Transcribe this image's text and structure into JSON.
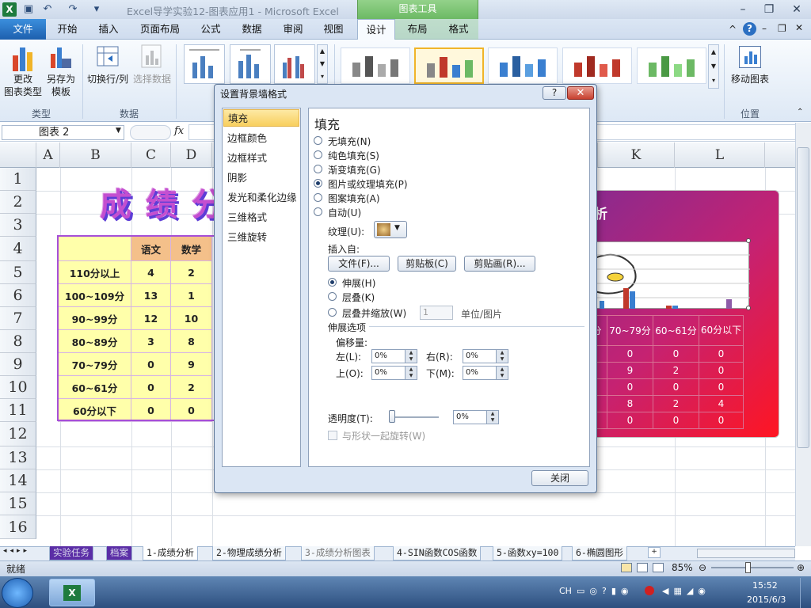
{
  "window": {
    "title": "Excel导学实验12-图表应用1 - Microsoft Excel",
    "context_group": "图表工具"
  },
  "tabs": {
    "file": "文件",
    "home": "开始",
    "insert": "插入",
    "page_layout": "页面布局",
    "formulas": "公式",
    "data": "数据",
    "review": "审阅",
    "view": "视图",
    "design": "设计",
    "layout": "布局",
    "format": "格式"
  },
  "ribbon": {
    "change_type_1": "更改",
    "change_type_2": "图表类型",
    "save_template_1": "另存为",
    "save_template_2": "模板",
    "switch_rowcol": "切换行/列",
    "select_data": "选择数据",
    "move_chart": "移动图表",
    "group_type": "类型",
    "group_data": "数据",
    "group_location": "位置"
  },
  "formula_bar": {
    "name_box": "图表 2",
    "fx": "fx"
  },
  "columns": [
    "A",
    "B",
    "C",
    "D",
    "K",
    "L"
  ],
  "rows": [
    "1",
    "2",
    "3",
    "4",
    "5",
    "6",
    "7",
    "8",
    "9",
    "10",
    "11",
    "12",
    "13",
    "14",
    "15",
    "16"
  ],
  "sheet": {
    "big_title": "成绩分",
    "headers": [
      "",
      "语文",
      "数学"
    ],
    "table": [
      [
        "110分以上",
        "4",
        "2"
      ],
      [
        "100~109分",
        "13",
        "1"
      ],
      [
        "90~99分",
        "12",
        "10"
      ],
      [
        "80~89分",
        "3",
        "8"
      ],
      [
        "70~79分",
        "0",
        "9"
      ],
      [
        "60~61分",
        "0",
        "2"
      ],
      [
        "60分以下",
        "0",
        "0"
      ]
    ]
  },
  "chart": {
    "title_fragment": "析",
    "header": [
      "分",
      "70~79分",
      "60~61分",
      "60分以下"
    ],
    "rows": [
      [
        "",
        "0",
        "0",
        "0"
      ],
      [
        "",
        "9",
        "2",
        "0"
      ],
      [
        "",
        "0",
        "0",
        "0"
      ],
      [
        "",
        "8",
        "2",
        "4"
      ],
      [
        "",
        "0",
        "0",
        "0"
      ]
    ]
  },
  "dialog": {
    "title": "设置背景墙格式",
    "help": "?",
    "close_x": "✕",
    "categories": [
      "填充",
      "边框颜色",
      "边框样式",
      "阴影",
      "发光和柔化边缘",
      "三维格式",
      "三维旋转"
    ],
    "panel_title": "填充",
    "fill_options": [
      "无填充(N)",
      "纯色填充(S)",
      "渐变填充(G)",
      "图片或纹理填充(P)",
      "图案填充(A)",
      "自动(U)"
    ],
    "texture_label": "纹理(U):",
    "insert_from": "插入自:",
    "btn_file": "文件(F)...",
    "btn_clipboard": "剪贴板(C)",
    "btn_clipart": "剪贴画(R)...",
    "stretch_options": [
      "伸展(H)",
      "层叠(K)",
      "层叠并缩放(W)"
    ],
    "scale_value": "1",
    "scale_unit": "单位/图片",
    "stretch_section": "伸展选项",
    "offset": "偏移量:",
    "left": "左(L):",
    "right": "右(R):",
    "top": "上(O):",
    "bottom": "下(M):",
    "left_val": "0%",
    "right_val": "0%",
    "top_val": "0%",
    "bottom_val": "0%",
    "transparency": "透明度(T):",
    "transparency_val": "0%",
    "rotate_with_shape": "与形状一起旋转(W)",
    "close_btn": "关闭"
  },
  "sheet_tabs": [
    "实验任务",
    "档案",
    "1-成绩分析",
    "2-物理成绩分析",
    "3-成绩分析图表",
    "4-SIN函数COS函数",
    "5-函数xy=100",
    "6-椭圆图形"
  ],
  "status": {
    "ready": "就绪",
    "zoom": "85%"
  },
  "taskbar": {
    "lang": "CH",
    "time": "15:52",
    "date": "2015/6/3"
  },
  "colors": {
    "accent_green": "#6cb964",
    "file_blue": "#1d5fae",
    "table_fill": "#ffffaa",
    "selection": "#a64ed8"
  }
}
